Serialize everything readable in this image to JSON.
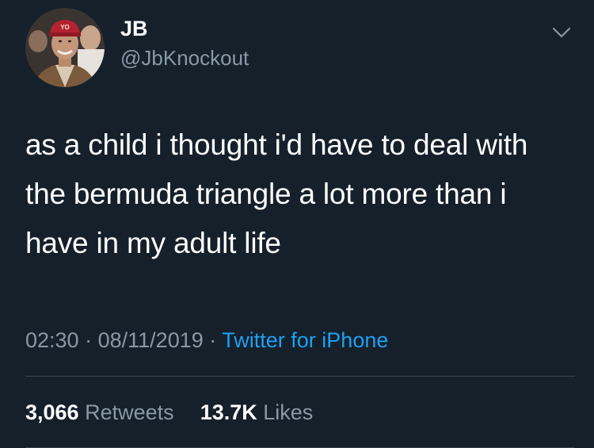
{
  "user": {
    "display_name": "JB",
    "handle": "@JbKnockout",
    "avatar_hat_text": "YO"
  },
  "tweet": {
    "text": "as a child i thought i'd have to deal with the bermuda triangle a lot more than i have in my adult life",
    "time": "02:30",
    "date": "08/11/2019",
    "separator": "·",
    "source": "Twitter for iPhone"
  },
  "stats": {
    "retweets_count": "3,066",
    "retweets_label": "Retweets",
    "likes_count": "13.7K",
    "likes_label": "Likes"
  },
  "icons": {
    "menu": "chevron-down-icon"
  },
  "colors": {
    "background": "#15202b",
    "primary_text": "#ffffff",
    "secondary_text": "#8899a6",
    "link": "#1da1f2",
    "divider": "#38444d"
  }
}
